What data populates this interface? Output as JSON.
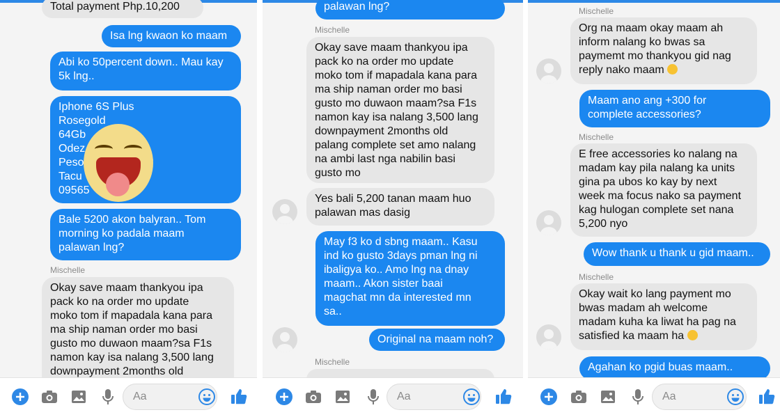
{
  "contact_name": "Mischelle",
  "composer_placeholder": "Aa",
  "colors": {
    "outgoing": "#1b87f0",
    "incoming": "#e6e6e6",
    "accent": "#2d88e6"
  },
  "icons": [
    "plus-icon",
    "camera-icon",
    "image-icon",
    "microphone-icon",
    "emoji-icon",
    "thumbs-up-icon"
  ],
  "panel1": {
    "m0": "Total payment Php.10,200",
    "m1": "Isa lng kwaon ko maam",
    "m2": "Abi ko 50percent down.. Mau kay\n5k lng..",
    "m3": "Iphone 6S Plus\nRosegold\n64Gb\nOdez        lahan\nPeso       ubd. Brgy\nTacu         City\n09565",
    "m4": "Bale 5200 akon balyran.. Tom\nmorning ko padala maam\npalawan lng?",
    "m5": "Okay save maam thankyou ipa\npack ko na order mo update\nmoko tom if mapadala kana para\nma ship naman order mo basi\ngusto mo duwaon maam?sa F1s\nnamon kay isa nalang 3,500 lang\ndownpayment 2months old"
  },
  "panel2": {
    "m0": "palawan lng?",
    "m1": "Okay save maam thankyou ipa\npack ko na order mo update\nmoko tom if mapadala kana para\nma ship naman order mo basi\ngusto mo duwaon maam?sa F1s\nnamon kay isa nalang 3,500 lang\ndownpayment 2months old\npalang complete set amo nalang\nna ambi last nga nabilin basi\ngusto mo",
    "m2": "Yes bali 5,200 tanan maam huo\npalawan mas dasig",
    "m3": "May f3 ko d sbng maam.. Kasu\nind ko gusto 3days pman lng ni\nibaligya ko.. Amo lng na dnay\nmaam.. Akon sister baai\nmagchat mn da interested mn\nsa..",
    "m4": "Original na maam noh?"
  },
  "panel3": {
    "m1": "Org na maam okay maam ah\ninform nalang ko bwas sa\npaymemt mo thankyou gid nag\nreply nako maam",
    "m2": "Maam ano ang +300 for\ncomplete accessories?",
    "m3": "E free accessories ko nalang na\nmadam kay pila nalang ka units\ngina pa ubos ko kay by next\nweek ma focus nako sa payment\nkag hulogan complete set nana\n5,200 nyo",
    "m4": "Wow thank u thank u gid maam..",
    "m5": "Okay wait ko lang payment mo\nbwas madam ah welcome\nmadam kuha ka liwat ha pag na\nsatisfied ka maam ha",
    "m6": "Agahan ko pgid buas maam.."
  }
}
